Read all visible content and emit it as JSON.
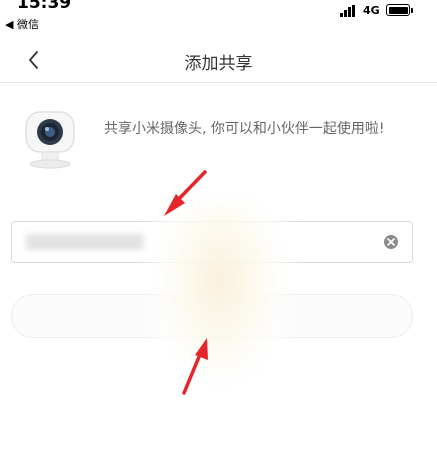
{
  "status_bar": {
    "time": "15:39",
    "back_app": "◀ 微信",
    "network": "4G",
    "battery": "full"
  },
  "navbar": {
    "title": "添加共享",
    "back_icon": "chevron-left-icon"
  },
  "intro": {
    "icon": "camera-icon",
    "text": "共享小米摄像头, 你可以和小伙伴一起使用啦!"
  },
  "input": {
    "value": "",
    "clear_icon": "clear-icon"
  },
  "share_button": {
    "label": ""
  },
  "annotations": {
    "arrow_color": "#e5252a"
  }
}
